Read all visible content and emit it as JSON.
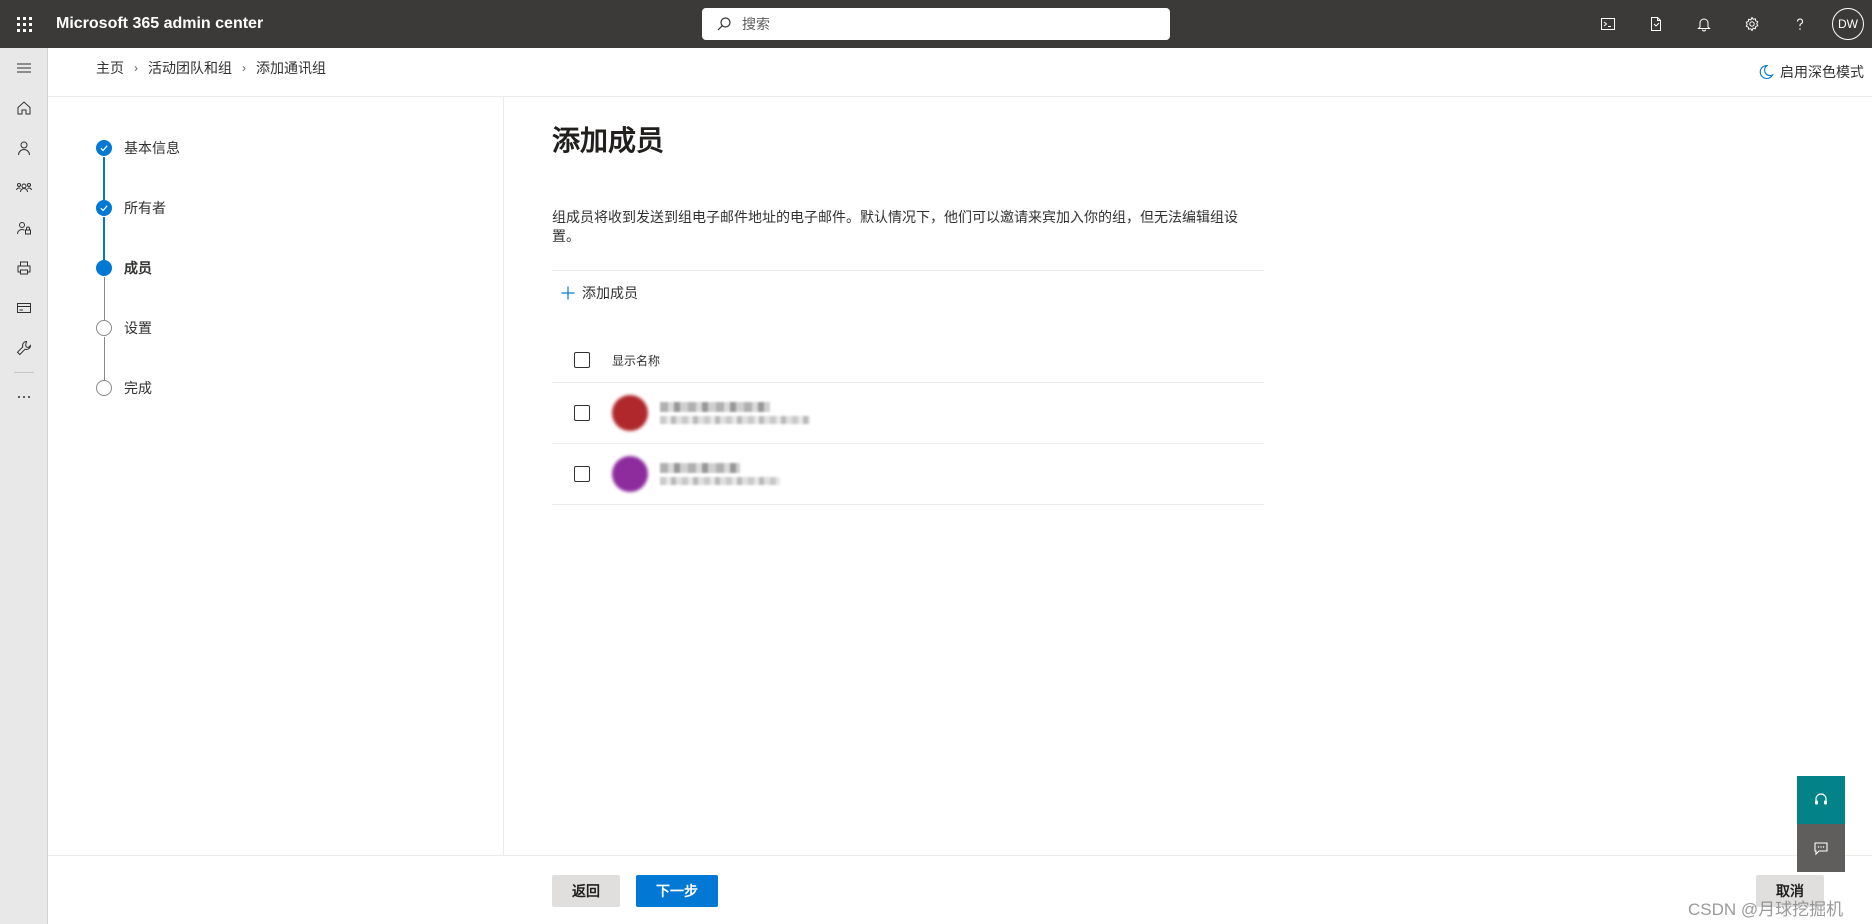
{
  "app": {
    "title": "Microsoft 365 admin center"
  },
  "search": {
    "placeholder": "搜索"
  },
  "topbar": {
    "icons": [
      "terminal-icon",
      "document-icon",
      "bell-icon",
      "gear-icon",
      "help-icon"
    ],
    "avatar_initials": "DW"
  },
  "leftnav": {
    "items": [
      "hamburger-icon",
      "home-icon",
      "user-icon",
      "group-icon",
      "user-key-icon",
      "printer-icon",
      "billing-card-icon",
      "wrench-icon",
      "more-icon"
    ]
  },
  "breadcrumb": {
    "items": [
      "主页",
      "活动团队和组",
      "添加通讯组"
    ]
  },
  "darkmode": {
    "label": "启用深色模式"
  },
  "stepper": {
    "steps": [
      {
        "label": "基本信息",
        "state": "done"
      },
      {
        "label": "所有者",
        "state": "done"
      },
      {
        "label": "成员",
        "state": "current"
      },
      {
        "label": "设置",
        "state": "todo"
      },
      {
        "label": "完成",
        "state": "todo"
      }
    ]
  },
  "main": {
    "title": "添加成员",
    "description": "组成员将收到发送到组电子邮件地址的电子邮件。默认情况下，他们可以邀请来宾加入你的组，但无法编辑组设置。",
    "add_member_label": "添加成员",
    "table": {
      "header": "显示名称",
      "rows": [
        {
          "avatar_color": "#b0282c"
        },
        {
          "avatar_color": "#8e2c9e"
        }
      ]
    }
  },
  "footer": {
    "back_label": "返回",
    "next_label": "下一步",
    "cancel_label": "取消"
  },
  "watermark": "CSDN @月球挖掘机",
  "colors": {
    "accent": "#0078d4",
    "topbar": "#3b3a39",
    "help": "#038387"
  }
}
